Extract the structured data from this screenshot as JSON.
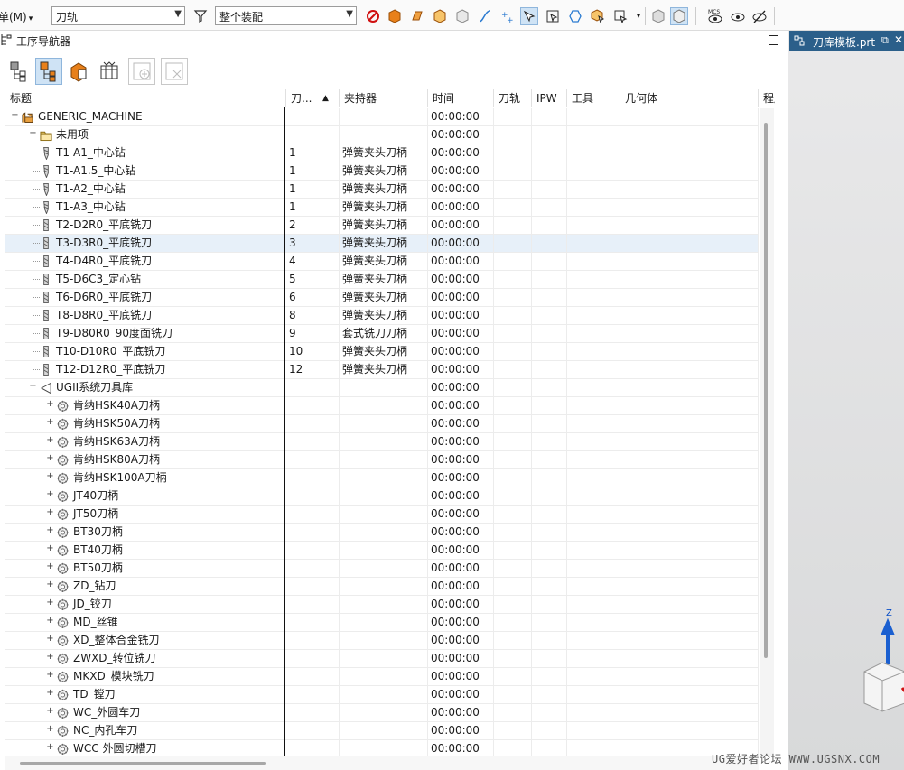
{
  "toolbar": {
    "menu_label": "单(M)",
    "filter_combo": "刀轨",
    "assembly_combo": "整个装配"
  },
  "navigator": {
    "title": "工序导航器",
    "columns": [
      "标题",
      "刀...",
      "夹持器",
      "时间",
      "刀轨",
      "IPW",
      "工具",
      "几何体",
      "程序"
    ],
    "root": "GENERIC_MACHINE",
    "rows": [
      {
        "name": "GENERIC_MACHINE",
        "num": "",
        "holder": "",
        "time": "00:00:00",
        "level": 0,
        "type": "machine",
        "exp": "−"
      },
      {
        "name": "未用项",
        "num": "",
        "holder": "",
        "time": "00:00:00",
        "level": 1,
        "type": "folder",
        "exp": "+"
      },
      {
        "name": "T1-A1_中心钻",
        "num": "1",
        "holder": "弹簧夹头刀柄",
        "time": "00:00:00",
        "level": 1,
        "type": "drill"
      },
      {
        "name": "T1-A1.5_中心钻",
        "num": "1",
        "holder": "弹簧夹头刀柄",
        "time": "00:00:00",
        "level": 1,
        "type": "drill"
      },
      {
        "name": "T1-A2_中心钻",
        "num": "1",
        "holder": "弹簧夹头刀柄",
        "time": "00:00:00",
        "level": 1,
        "type": "drill"
      },
      {
        "name": "T1-A3_中心钻",
        "num": "1",
        "holder": "弹簧夹头刀柄",
        "time": "00:00:00",
        "level": 1,
        "type": "drill"
      },
      {
        "name": "T2-D2R0_平底铣刀",
        "num": "2",
        "holder": "弹簧夹头刀柄",
        "time": "00:00:00",
        "level": 1,
        "type": "mill"
      },
      {
        "name": "T3-D3R0_平底铣刀",
        "num": "3",
        "holder": "弹簧夹头刀柄",
        "time": "00:00:00",
        "level": 1,
        "type": "mill",
        "selected": true
      },
      {
        "name": "T4-D4R0_平底铣刀",
        "num": "4",
        "holder": "弹簧夹头刀柄",
        "time": "00:00:00",
        "level": 1,
        "type": "mill"
      },
      {
        "name": "T5-D6C3_定心钻",
        "num": "5",
        "holder": "弹簧夹头刀柄",
        "time": "00:00:00",
        "level": 1,
        "type": "mill"
      },
      {
        "name": "T6-D6R0_平底铣刀",
        "num": "6",
        "holder": "弹簧夹头刀柄",
        "time": "00:00:00",
        "level": 1,
        "type": "mill"
      },
      {
        "name": "T8-D8R0_平底铣刀",
        "num": "8",
        "holder": "弹簧夹头刀柄",
        "time": "00:00:00",
        "level": 1,
        "type": "mill"
      },
      {
        "name": "T9-D80R0_90度面铣刀",
        "num": "9",
        "holder": "套式铣刀刀柄",
        "time": "00:00:00",
        "level": 1,
        "type": "mill"
      },
      {
        "name": "T10-D10R0_平底铣刀",
        "num": "10",
        "holder": "弹簧夹头刀柄",
        "time": "00:00:00",
        "level": 1,
        "type": "mill"
      },
      {
        "name": "T12-D12R0_平底铣刀",
        "num": "12",
        "holder": "弹簧夹头刀柄",
        "time": "00:00:00",
        "level": 1,
        "type": "mill"
      },
      {
        "name": "UGII系统刀具库",
        "num": "",
        "holder": "",
        "time": "00:00:00",
        "level": 1,
        "type": "library",
        "exp": "−"
      },
      {
        "name": "肯纳HSK40A刀柄",
        "num": "",
        "holder": "",
        "time": "00:00:00",
        "level": 2,
        "type": "gear",
        "exp": "+"
      },
      {
        "name": "肯纳HSK50A刀柄",
        "num": "",
        "holder": "",
        "time": "00:00:00",
        "level": 2,
        "type": "gear",
        "exp": "+"
      },
      {
        "name": "肯纳HSK63A刀柄",
        "num": "",
        "holder": "",
        "time": "00:00:00",
        "level": 2,
        "type": "gear",
        "exp": "+"
      },
      {
        "name": "肯纳HSK80A刀柄",
        "num": "",
        "holder": "",
        "time": "00:00:00",
        "level": 2,
        "type": "gear",
        "exp": "+"
      },
      {
        "name": "肯纳HSK100A刀柄",
        "num": "",
        "holder": "",
        "time": "00:00:00",
        "level": 2,
        "type": "gear",
        "exp": "+"
      },
      {
        "name": "JT40刀柄",
        "num": "",
        "holder": "",
        "time": "00:00:00",
        "level": 2,
        "type": "gear",
        "exp": "+"
      },
      {
        "name": "JT50刀柄",
        "num": "",
        "holder": "",
        "time": "00:00:00",
        "level": 2,
        "type": "gear",
        "exp": "+"
      },
      {
        "name": "BT30刀柄",
        "num": "",
        "holder": "",
        "time": "00:00:00",
        "level": 2,
        "type": "gear",
        "exp": "+"
      },
      {
        "name": "BT40刀柄",
        "num": "",
        "holder": "",
        "time": "00:00:00",
        "level": 2,
        "type": "gear",
        "exp": "+"
      },
      {
        "name": "BT50刀柄",
        "num": "",
        "holder": "",
        "time": "00:00:00",
        "level": 2,
        "type": "gear",
        "exp": "+"
      },
      {
        "name": "ZD_钻刀",
        "num": "",
        "holder": "",
        "time": "00:00:00",
        "level": 2,
        "type": "gear",
        "exp": "+"
      },
      {
        "name": "JD_铰刀",
        "num": "",
        "holder": "",
        "time": "00:00:00",
        "level": 2,
        "type": "gear",
        "exp": "+"
      },
      {
        "name": "MD_丝锥",
        "num": "",
        "holder": "",
        "time": "00:00:00",
        "level": 2,
        "type": "gear",
        "exp": "+"
      },
      {
        "name": "XD_整体合金铣刀",
        "num": "",
        "holder": "",
        "time": "00:00:00",
        "level": 2,
        "type": "gear",
        "exp": "+"
      },
      {
        "name": "ZWXD_转位铣刀",
        "num": "",
        "holder": "",
        "time": "00:00:00",
        "level": 2,
        "type": "gear",
        "exp": "+"
      },
      {
        "name": "MKXD_模块铣刀",
        "num": "",
        "holder": "",
        "time": "00:00:00",
        "level": 2,
        "type": "gear",
        "exp": "+"
      },
      {
        "name": "TD_镗刀",
        "num": "",
        "holder": "",
        "time": "00:00:00",
        "level": 2,
        "type": "gear",
        "exp": "+"
      },
      {
        "name": "WC_外圆车刀",
        "num": "",
        "holder": "",
        "time": "00:00:00",
        "level": 2,
        "type": "gear",
        "exp": "+"
      },
      {
        "name": "NC_内孔车刀",
        "num": "",
        "holder": "",
        "time": "00:00:00",
        "level": 2,
        "type": "gear",
        "exp": "+"
      },
      {
        "name": "WCC 外圆切槽刀",
        "num": "",
        "holder": "",
        "time": "00:00:00",
        "level": 2,
        "type": "gear",
        "exp": "+"
      }
    ]
  },
  "viewport": {
    "tab_title": "刀库模板.prt",
    "axis_label": "Z"
  },
  "watermark": "UG爱好者论坛 WWW.UGSNX.COM",
  "colors": {
    "accent": "#2b5f8a",
    "selected_row": "#e7f0f9",
    "orange_icon": "#e8801a"
  }
}
